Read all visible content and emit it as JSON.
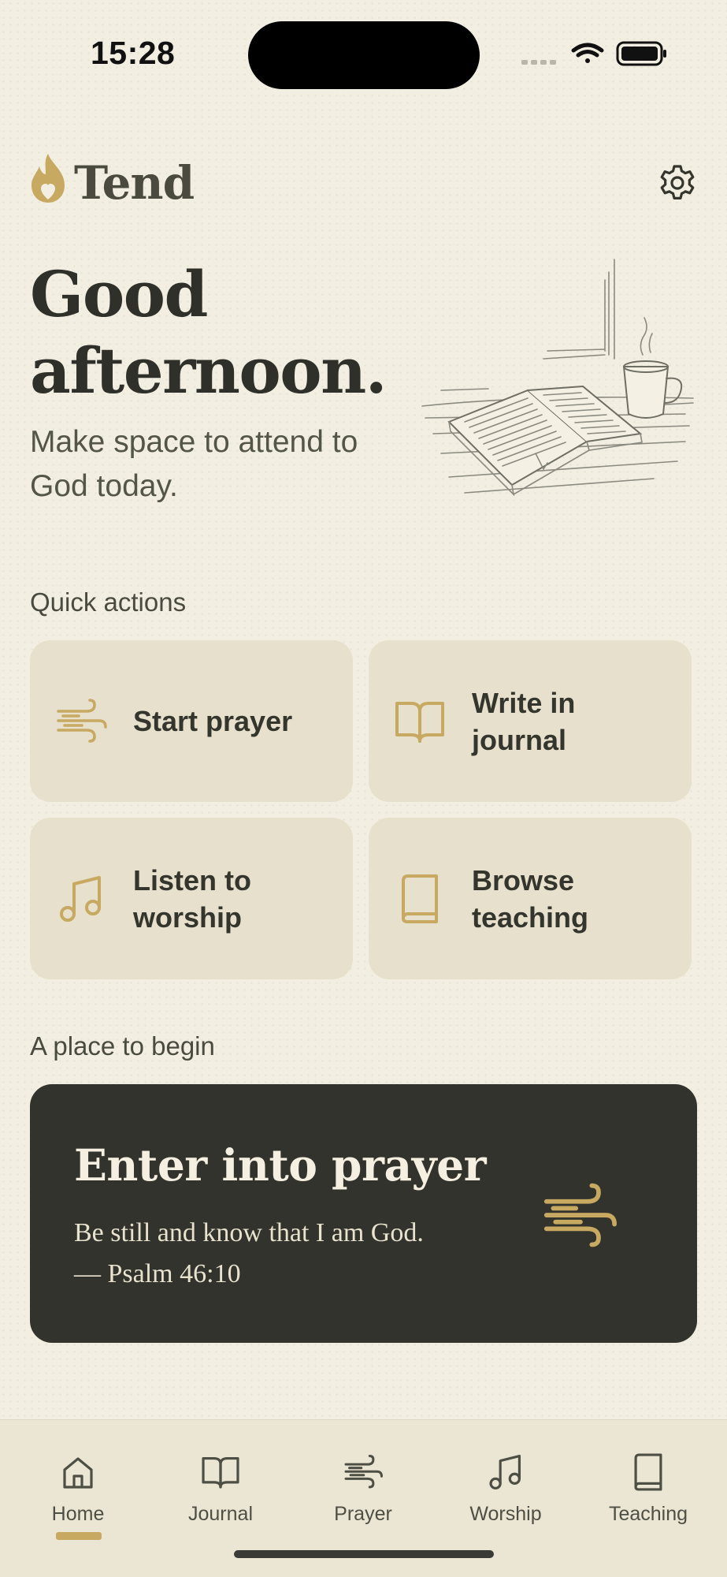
{
  "status_bar": {
    "time": "15:28"
  },
  "header": {
    "app_name": "Tend"
  },
  "greeting": {
    "title_line1": "Good",
    "title_line2": "afternoon.",
    "subtitle_line1": "Make space to attend to",
    "subtitle_line2": "God today."
  },
  "quick_actions": {
    "label": "Quick actions",
    "items": [
      {
        "line1": "Start prayer",
        "line2": "",
        "icon": "wind-icon"
      },
      {
        "line1": "Write in",
        "line2": "journal",
        "icon": "open-book-icon"
      },
      {
        "line1": "Listen to",
        "line2": "worship",
        "icon": "music-note-icon"
      },
      {
        "line1": "Browse",
        "line2": "teaching",
        "icon": "book-icon"
      }
    ]
  },
  "featured": {
    "section_label": "A place to begin",
    "title": "Enter into prayer",
    "verse_line1": "Be still and know that I am God.",
    "verse_line2": "— Psalm 46:10"
  },
  "tab_bar": {
    "active": "Home",
    "tabs": [
      {
        "label": "Home",
        "icon": "home-icon"
      },
      {
        "label": "Journal",
        "icon": "open-book-icon"
      },
      {
        "label": "Prayer",
        "icon": "wind-icon"
      },
      {
        "label": "Worship",
        "icon": "music-note-icon"
      },
      {
        "label": "Teaching",
        "icon": "book-icon"
      }
    ]
  },
  "colors": {
    "background": "#f2eee1",
    "card": "#e7e0cc",
    "accent_gold": "#c7a961",
    "dark_card": "#31332c",
    "text_dark": "#2f3029"
  }
}
